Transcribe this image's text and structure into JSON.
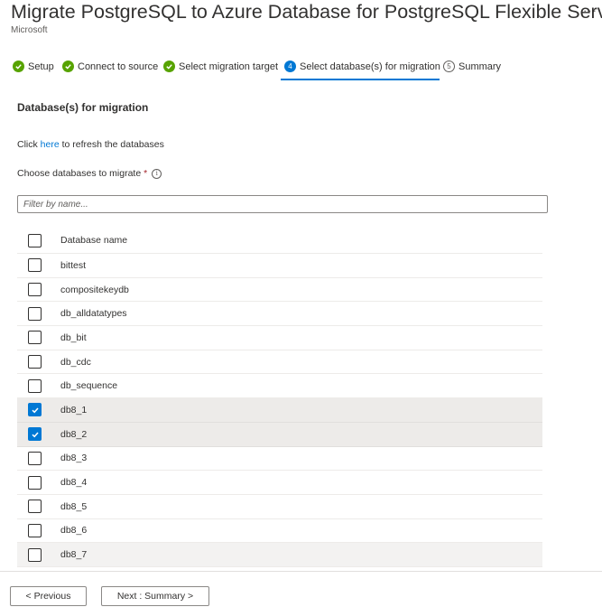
{
  "header": {
    "title": "Migrate PostgreSQL to Azure Database for PostgreSQL Flexible Server",
    "subtitle": "Microsoft",
    "more": "···"
  },
  "steps": [
    {
      "label": "Setup",
      "status": "done",
      "icon": "checkmark-icon"
    },
    {
      "label": "Connect to source",
      "status": "done",
      "icon": "checkmark-icon"
    },
    {
      "label": "Select migration target",
      "status": "done",
      "icon": "checkmark-icon"
    },
    {
      "label": "Select database(s) for migration",
      "status": "current",
      "number": "4"
    },
    {
      "label": "Summary",
      "status": "todo",
      "number": "5"
    }
  ],
  "section_title": "Database(s) for migration",
  "refresh": {
    "prefix": "Click ",
    "link": "here",
    "suffix": " to refresh the databases"
  },
  "choose": {
    "label": "Choose databases to migrate",
    "required": "*",
    "info": "i"
  },
  "filter": {
    "placeholder": "Filter by name...",
    "value": ""
  },
  "table": {
    "header": "Database name",
    "rows": [
      {
        "name": "bittest",
        "checked": false
      },
      {
        "name": "compositekeydb",
        "checked": false
      },
      {
        "name": "db_alldatatypes",
        "checked": false
      },
      {
        "name": "db_bit",
        "checked": false
      },
      {
        "name": "db_cdc",
        "checked": false
      },
      {
        "name": "db_sequence",
        "checked": false
      },
      {
        "name": "db8_1",
        "checked": true
      },
      {
        "name": "db8_2",
        "checked": true
      },
      {
        "name": "db8_3",
        "checked": false
      },
      {
        "name": "db8_4",
        "checked": false
      },
      {
        "name": "db8_5",
        "checked": false
      },
      {
        "name": "db8_6",
        "checked": false
      },
      {
        "name": "db8_7",
        "checked": false
      }
    ]
  },
  "footer": {
    "previous": "< Previous",
    "next": "Next : Summary >"
  },
  "colors": {
    "accent": "#0078d4",
    "success": "#57a300",
    "required": "#a4262c"
  }
}
